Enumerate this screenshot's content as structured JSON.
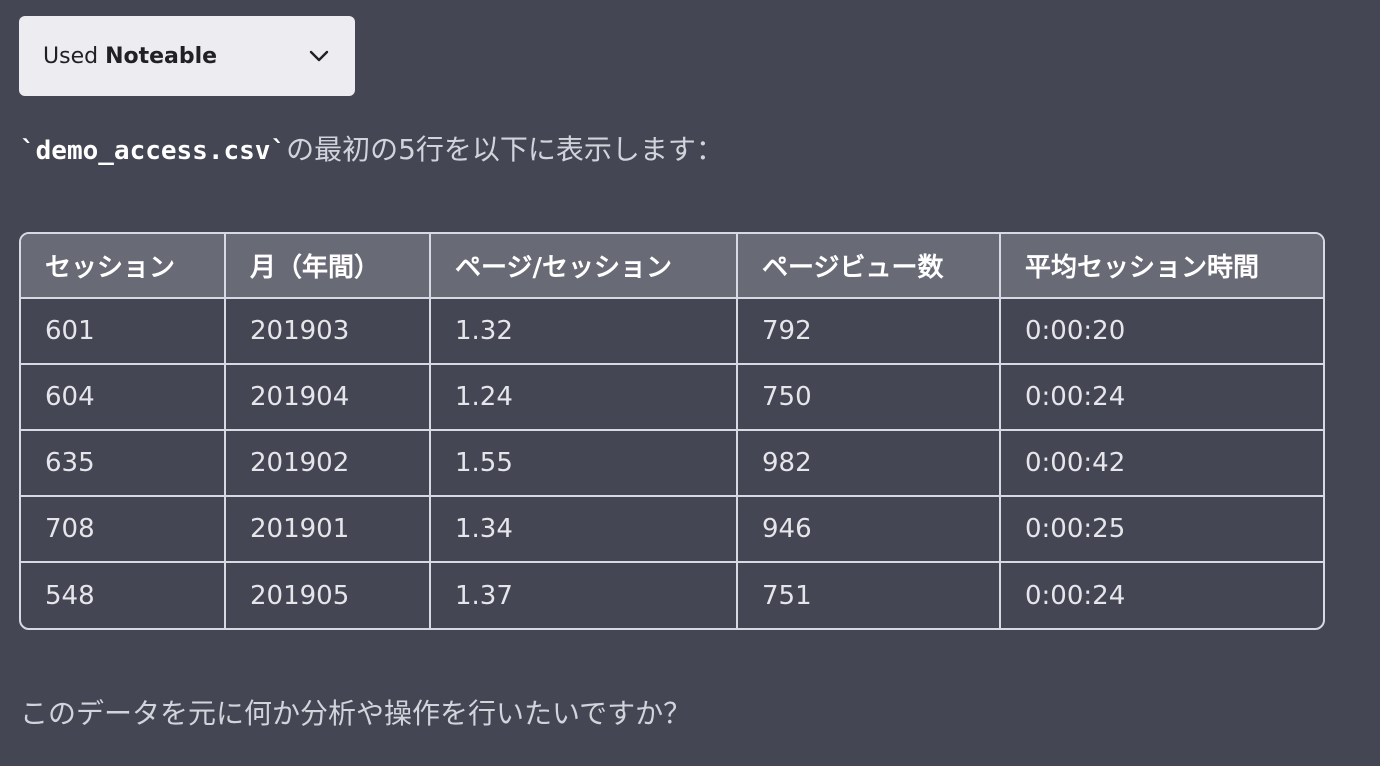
{
  "plugin": {
    "prefix": "Used",
    "name": "Noteable"
  },
  "message": {
    "filename": "`demo_access.csv`",
    "intro_text": "の最初の5行を以下に表示します：",
    "outro_text": "このデータを元に何か分析や操作を行いたいですか？"
  },
  "table": {
    "headers": [
      "セッション",
      "月（年間）",
      "ページ/セッション",
      "ページビュー数",
      "平均セッション時間"
    ],
    "rows": [
      [
        "601",
        "201903",
        "1.32",
        "792",
        "0:00:20"
      ],
      [
        "604",
        "201904",
        "1.24",
        "750",
        "0:00:24"
      ],
      [
        "635",
        "201902",
        "1.55",
        "982",
        "0:00:42"
      ],
      [
        "708",
        "201901",
        "1.34",
        "946",
        "0:00:25"
      ],
      [
        "548",
        "201905",
        "1.37",
        "751",
        "0:00:24"
      ]
    ]
  },
  "icons": {
    "dropdown": "chevron-down-icon"
  }
}
